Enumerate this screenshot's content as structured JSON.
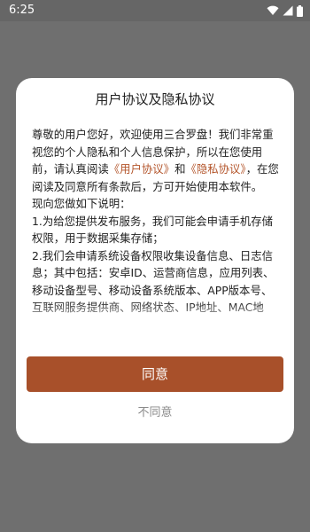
{
  "status_bar": {
    "time": "6:25",
    "icons": [
      "wifi-icon",
      "signal-icon",
      "battery-icon"
    ]
  },
  "dialog": {
    "title": "用户协议及隐私协议",
    "body": {
      "p1_part1": "尊敬的用户您好，欢迎使用三合罗盘！我们非常重视您的个人隐私和个人信息保护，所以在您使用前，请认真阅读",
      "link_user_agreement": "《用户协议》",
      "p1_and": "和",
      "link_privacy_agreement": "《隐私协议》",
      "p1_part2": "，在您阅读及同意所有条款后，方可开始使用本软件。",
      "p2": "现向您做如下说明：",
      "p3": "1.为给您提供发布服务，我们可能会申请手机存储权限，用于数据采集存储；",
      "p4": "2.我们会申请系统设备权限收集设备信息、日志信息；其中包括：安卓ID、运营商信息，应用列表、移动设备型号、移动设备系统版本、APP版本号、互联网服务提供商、网络状态、IP地址、MAC地址、IMEI、SIM卡IMSI信息"
    },
    "agree_label": "同意",
    "disagree_label": "不同意"
  },
  "colors": {
    "accent": "#a8502a",
    "link": "#b4562c",
    "overlay": "#6f6f6f"
  }
}
